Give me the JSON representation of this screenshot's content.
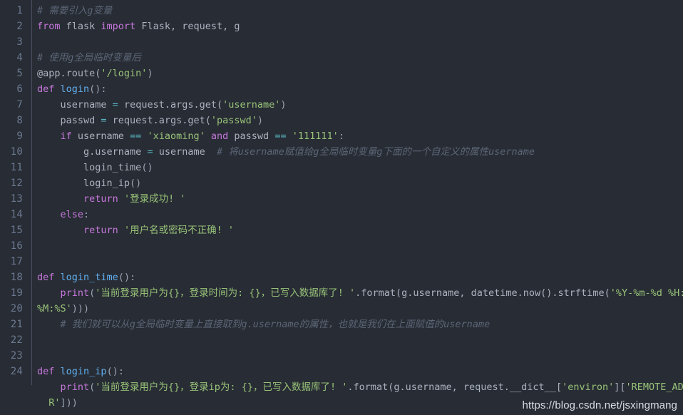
{
  "editor": {
    "background_color": "#282c34",
    "gutter_color": "#6b7a91",
    "text_color": "#abb2bf",
    "language": "python",
    "line_numbers": [
      "1",
      "2",
      "3",
      "4",
      "5",
      "6",
      "7",
      "8",
      "9",
      "10",
      "11",
      "12",
      "13",
      "14",
      "15",
      "16",
      "17",
      "18",
      "19",
      "20",
      "21",
      "22",
      "23",
      "24"
    ],
    "syntax_colors": {
      "comment": "#5c6677",
      "keyword": "#c678dd",
      "function": "#61afef",
      "string": "#98c379",
      "identifier": "#abb2bf",
      "operator": "#56b6c2",
      "punctuation": "#9aa3b2"
    },
    "lines": [
      {
        "number": "1",
        "tokens": [
          {
            "t": "cm",
            "v": "# 需要引入g变量"
          }
        ]
      },
      {
        "number": "2",
        "tokens": [
          {
            "t": "kw",
            "v": "from"
          },
          {
            "t": "id",
            "v": " flask "
          },
          {
            "t": "kw",
            "v": "import"
          },
          {
            "t": "id",
            "v": " Flask, request, g"
          }
        ]
      },
      {
        "number": "3",
        "tokens": []
      },
      {
        "number": "4",
        "tokens": [
          {
            "t": "cm",
            "v": "# 使用g全局临时变量后"
          }
        ]
      },
      {
        "number": "5",
        "tokens": [
          {
            "t": "dec",
            "v": "@app.route("
          },
          {
            "t": "str",
            "v": "'/login'"
          },
          {
            "t": "pn",
            "v": ")"
          }
        ]
      },
      {
        "number": "6",
        "tokens": [
          {
            "t": "kw",
            "v": "def"
          },
          {
            "t": "id",
            "v": " "
          },
          {
            "t": "fn",
            "v": "login"
          },
          {
            "t": "pn",
            "v": "():"
          }
        ]
      },
      {
        "number": "7",
        "tokens": [
          {
            "t": "id",
            "v": "    username "
          },
          {
            "t": "op",
            "v": "="
          },
          {
            "t": "id",
            "v": " request.args.get("
          },
          {
            "t": "str",
            "v": "'username'"
          },
          {
            "t": "pn",
            "v": ")"
          }
        ]
      },
      {
        "number": "8",
        "tokens": [
          {
            "t": "id",
            "v": "    passwd "
          },
          {
            "t": "op",
            "v": "="
          },
          {
            "t": "id",
            "v": " request.args.get("
          },
          {
            "t": "str",
            "v": "'passwd'"
          },
          {
            "t": "pn",
            "v": ")"
          }
        ]
      },
      {
        "number": "9",
        "tokens": [
          {
            "t": "id",
            "v": "    "
          },
          {
            "t": "kw",
            "v": "if"
          },
          {
            "t": "id",
            "v": " username "
          },
          {
            "t": "op",
            "v": "=="
          },
          {
            "t": "id",
            "v": " "
          },
          {
            "t": "str",
            "v": "'xiaoming'"
          },
          {
            "t": "id",
            "v": " "
          },
          {
            "t": "kw",
            "v": "and"
          },
          {
            "t": "id",
            "v": " passwd "
          },
          {
            "t": "op",
            "v": "=="
          },
          {
            "t": "id",
            "v": " "
          },
          {
            "t": "str",
            "v": "'111111'"
          },
          {
            "t": "pn",
            "v": ":"
          }
        ]
      },
      {
        "number": "10",
        "tokens": [
          {
            "t": "id",
            "v": "        g.username "
          },
          {
            "t": "op",
            "v": "="
          },
          {
            "t": "id",
            "v": " username  "
          },
          {
            "t": "cm",
            "v": "# 将username赋值给g全局临时变量g下面的一个自定义的属性username"
          }
        ]
      },
      {
        "number": "11",
        "tokens": [
          {
            "t": "id",
            "v": "        login_time"
          },
          {
            "t": "pn",
            "v": "()"
          }
        ]
      },
      {
        "number": "12",
        "tokens": [
          {
            "t": "id",
            "v": "        login_ip"
          },
          {
            "t": "pn",
            "v": "()"
          }
        ]
      },
      {
        "number": "13",
        "tokens": [
          {
            "t": "id",
            "v": "        "
          },
          {
            "t": "kw",
            "v": "return"
          },
          {
            "t": "id",
            "v": " "
          },
          {
            "t": "str",
            "v": "'登录成功! '"
          }
        ]
      },
      {
        "number": "14",
        "tokens": [
          {
            "t": "id",
            "v": "    "
          },
          {
            "t": "kw",
            "v": "else"
          },
          {
            "t": "pn",
            "v": ":"
          }
        ]
      },
      {
        "number": "15",
        "tokens": [
          {
            "t": "id",
            "v": "        "
          },
          {
            "t": "kw",
            "v": "return"
          },
          {
            "t": "id",
            "v": " "
          },
          {
            "t": "str",
            "v": "'用户名或密码不正确! '"
          }
        ]
      },
      {
        "number": "16",
        "tokens": []
      },
      {
        "number": "17",
        "tokens": []
      },
      {
        "number": "18",
        "tokens": [
          {
            "t": "kw",
            "v": "def"
          },
          {
            "t": "id",
            "v": " "
          },
          {
            "t": "fn",
            "v": "login_time"
          },
          {
            "t": "pn",
            "v": "():"
          }
        ]
      },
      {
        "number": "19",
        "tokens": [
          {
            "t": "id",
            "v": "    "
          },
          {
            "t": "kw",
            "v": "print"
          },
          {
            "t": "pn",
            "v": "("
          },
          {
            "t": "str",
            "v": "'当前登录用户为{}，登录时间为: {}，已写入数据库了! '"
          },
          {
            "t": "id",
            "v": ".format(g.username, datetime.now().strftime("
          },
          {
            "t": "str",
            "v": "'%Y-%m-%d %H:"
          }
        ]
      },
      {
        "number": "20",
        "tokens": [
          {
            "t": "str",
            "v": "%M:%S'"
          },
          {
            "t": "pn",
            "v": ")))"
          }
        ]
      },
      {
        "number": "21",
        "tokens": [
          {
            "t": "id",
            "v": "    "
          },
          {
            "t": "cm",
            "v": "# 我们就可以从g全局临时变量上直接取到g.username的属性，也就是我们在上面赋值的username"
          }
        ]
      },
      {
        "number": "22",
        "tokens": []
      },
      {
        "number": "23",
        "tokens": []
      },
      {
        "number": "24",
        "tokens": [
          {
            "t": "kw",
            "v": "def"
          },
          {
            "t": "id",
            "v": " "
          },
          {
            "t": "fn",
            "v": "login_ip"
          },
          {
            "t": "pn",
            "v": "():"
          }
        ]
      },
      {
        "number": "",
        "tokens": [
          {
            "t": "id",
            "v": "    "
          },
          {
            "t": "kw",
            "v": "print"
          },
          {
            "t": "pn",
            "v": "("
          },
          {
            "t": "str",
            "v": "'当前登录用户为{}，登录ip为: {}，已写入数据库了! '"
          },
          {
            "t": "id",
            "v": ".format(g.username, request.__dict__["
          },
          {
            "t": "str",
            "v": "'environ'"
          },
          {
            "t": "id",
            "v": "]["
          },
          {
            "t": "str",
            "v": "'REMOTE_ADD"
          }
        ]
      },
      {
        "number": "",
        "tokens": [
          {
            "t": "str",
            "v": "  R'"
          },
          {
            "t": "pn",
            "v": "]))"
          }
        ]
      }
    ]
  },
  "watermark": {
    "text": "https://blog.csdn.net/jsxingmang"
  }
}
